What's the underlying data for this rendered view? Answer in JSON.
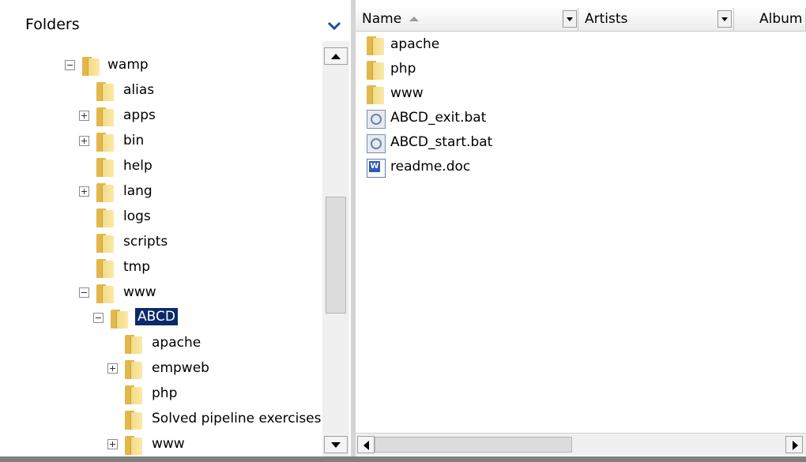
{
  "folders_pane": {
    "title": "Folders",
    "toggle_icon": "chevron-down-icon",
    "tree": [
      {
        "label": "wamp",
        "expander": "minus"
      },
      {
        "label": "alias"
      },
      {
        "label": "apps",
        "expander": "plus"
      },
      {
        "label": "bin",
        "expander": "plus"
      },
      {
        "label": "help"
      },
      {
        "label": "lang",
        "expander": "plus"
      },
      {
        "label": "logs"
      },
      {
        "label": "scripts"
      },
      {
        "label": "tmp"
      },
      {
        "label": "www",
        "expander": "minus"
      },
      {
        "label": "ABCD",
        "expander": "minus",
        "selected": true
      },
      {
        "label": "apache"
      },
      {
        "label": "empweb",
        "expander": "plus"
      },
      {
        "label": "php"
      },
      {
        "label": "Solved pipeline exercises"
      },
      {
        "label": "www",
        "expander": "plus"
      }
    ]
  },
  "files_pane": {
    "columns": [
      "Name",
      "Artists",
      "Album"
    ],
    "sorted_column": "Name",
    "files": [
      {
        "name": "apache",
        "type": "folder"
      },
      {
        "name": "php",
        "type": "folder"
      },
      {
        "name": "www",
        "type": "folder"
      },
      {
        "name": "ABCD_exit.bat",
        "type": "bat"
      },
      {
        "name": "ABCD_start.bat",
        "type": "bat"
      },
      {
        "name": "readme.doc",
        "type": "doc"
      }
    ]
  },
  "colors": {
    "selection": "#0a2a6b",
    "folder": "#e2b84a",
    "chrome": "#f0f0f0"
  }
}
